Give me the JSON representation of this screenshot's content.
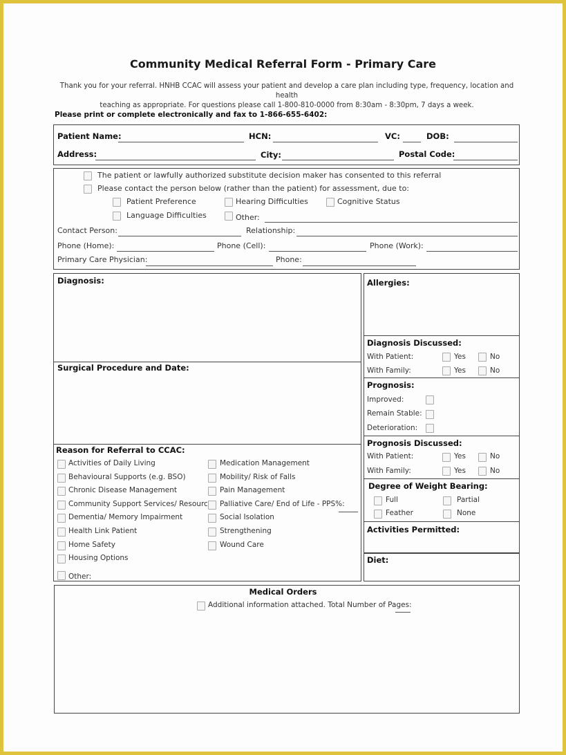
{
  "header": {
    "title": "Community Medical Referral Form - Primary Care",
    "intro_line1": "Thank you for your referral. HNHB CCAC will assess your patient and develop a care plan including type, frequency, location and health",
    "intro_line2": "teaching as appropriate. For questions please call 1-800-810-0000 from 8:30am - 8:30pm, 7 days a week.",
    "fax_instruction": "Please print or complete electronically and fax to 1-866-655-6402:"
  },
  "patient": {
    "name_label": "Patient Name:",
    "hcn_label": "HCN:",
    "vc_label": "VC:",
    "dob_label": "DOB:",
    "address_label": "Address:",
    "city_label": "City:",
    "postal_label": "Postal Code:",
    "name_value": "",
    "hcn_value": "",
    "vc_value": "",
    "dob_value": "",
    "address_value": "",
    "city_value": "",
    "postal_value": ""
  },
  "consent": {
    "consent_label": "The patient or lawfully authorized substitute decision maker has consented to this referral",
    "contact_label": "Please contact the person below (rather than the patient) for assessment, due to:",
    "reasons": [
      {
        "label": "Patient Preference",
        "checked": false
      },
      {
        "label": "Hearing Difficulties",
        "checked": false
      },
      {
        "label": "Cognitive Status",
        "checked": false
      },
      {
        "label": "Language Difficulties",
        "checked": false
      },
      {
        "label": "Other:",
        "checked": false
      }
    ],
    "contact_person_label": "Contact Person:",
    "relationship_label": "Relationship:",
    "phone_home_label": "Phone (Home):",
    "phone_cell_label": "Phone (Cell):",
    "phone_work_label": "Phone (Work):",
    "physician_label": "Primary Care Physician:",
    "physician_phone_label": "Phone:"
  },
  "clinical": {
    "diagnosis_label": "Diagnosis:",
    "surgical_label": "Surgical Procedure and Date:",
    "allergies_label": "Allergies:",
    "diagnosis_discussed": {
      "title": "Diagnosis Discussed:",
      "with_patient": "With Patient:",
      "with_family": "With Family:",
      "yes": "Yes",
      "no": "No"
    },
    "prognosis": {
      "title": "Prognosis:",
      "improved": "Improved:",
      "stable": "Remain Stable:",
      "deterioration": "Deterioration:"
    },
    "prognosis_discussed": {
      "title": "Prognosis Discussed:",
      "with_patient": "With Patient:",
      "with_family": "With Family:",
      "yes": "Yes",
      "no": "No"
    },
    "weight_bearing": {
      "title": "Degree of Weight Bearing:",
      "full": "Full",
      "partial": "Partial",
      "feather": "Feather",
      "none": "None"
    },
    "activities_label": "Activities Permitted:",
    "diet_label": "Diet:"
  },
  "referral": {
    "title": "Reason for Referral to CCAC:",
    "left": [
      "Activities of Daily Living",
      "Behavioural Supports (e.g. BSO)",
      "Chronic Disease Management",
      "Community Support Services/ Resources",
      "Dementia/ Memory Impairment",
      "Health Link Patient",
      "Home Safety",
      "Housing Options",
      "Other:"
    ],
    "right": [
      "Medication Management",
      "Mobility/ Risk of Falls",
      "Pain Management",
      "Palliative Care/ End of Life - PPS%:",
      "Social Isolation",
      "Strengthening",
      "Wound Care"
    ]
  },
  "orders": {
    "title": "Medical Orders",
    "attached_label": "Additional information attached. Total Number of Pages:"
  }
}
